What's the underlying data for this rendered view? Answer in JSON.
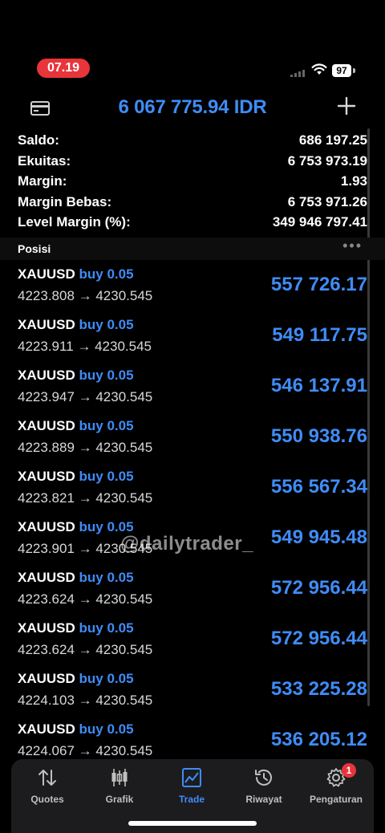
{
  "status": {
    "time": "07.19",
    "battery": "97"
  },
  "header": {
    "balance_title": "6 067 775.94 IDR"
  },
  "summary": [
    {
      "label": "Saldo:",
      "value": "686 197.25"
    },
    {
      "label": "Ekuitas:",
      "value": "6 753 973.19"
    },
    {
      "label": "Margin:",
      "value": "1.93"
    },
    {
      "label": "Margin Bebas:",
      "value": "6 753 971.26"
    },
    {
      "label": "Level Margin (%):",
      "value": "349 946 797.41"
    }
  ],
  "positions_label": "Posisi",
  "positions": [
    {
      "symbol": "XAUUSD",
      "side": "buy 0.05",
      "prices": "4223.808 → 4230.545",
      "profit": "557 726.17"
    },
    {
      "symbol": "XAUUSD",
      "side": "buy 0.05",
      "prices": "4223.911 → 4230.545",
      "profit": "549 117.75"
    },
    {
      "symbol": "XAUUSD",
      "side": "buy 0.05",
      "prices": "4223.947 → 4230.545",
      "profit": "546 137.91"
    },
    {
      "symbol": "XAUUSD",
      "side": "buy 0.05",
      "prices": "4223.889 → 4230.545",
      "profit": "550 938.76"
    },
    {
      "symbol": "XAUUSD",
      "side": "buy 0.05",
      "prices": "4223.821 → 4230.545",
      "profit": "556 567.34"
    },
    {
      "symbol": "XAUUSD",
      "side": "buy 0.05",
      "prices": "4223.901 → 4230.545",
      "profit": "549 945.48"
    },
    {
      "symbol": "XAUUSD",
      "side": "buy 0.05",
      "prices": "4223.624 → 4230.545",
      "profit": "572 956.44"
    },
    {
      "symbol": "XAUUSD",
      "side": "buy 0.05",
      "prices": "4223.624 → 4230.545",
      "profit": "572 956.44"
    },
    {
      "symbol": "XAUUSD",
      "side": "buy 0.05",
      "prices": "4224.103 → 4230.545",
      "profit": "533 225.28"
    },
    {
      "symbol": "XAUUSD",
      "side": "buy 0.05",
      "prices": "4224.067 → 4230.545",
      "profit": "536 205.12"
    }
  ],
  "watermark": "@dailytrader_",
  "tabs": [
    {
      "label": "Quotes",
      "icon": "quotes-icon"
    },
    {
      "label": "Grafik",
      "icon": "chart-candles-icon"
    },
    {
      "label": "Trade",
      "icon": "trade-icon",
      "active": true
    },
    {
      "label": "Riwayat",
      "icon": "history-icon"
    },
    {
      "label": "Pengaturan",
      "icon": "settings-icon",
      "badge": "1"
    }
  ],
  "colors": {
    "accent": "#3f8cf7",
    "badge": "#e8353a",
    "background": "#000000"
  }
}
